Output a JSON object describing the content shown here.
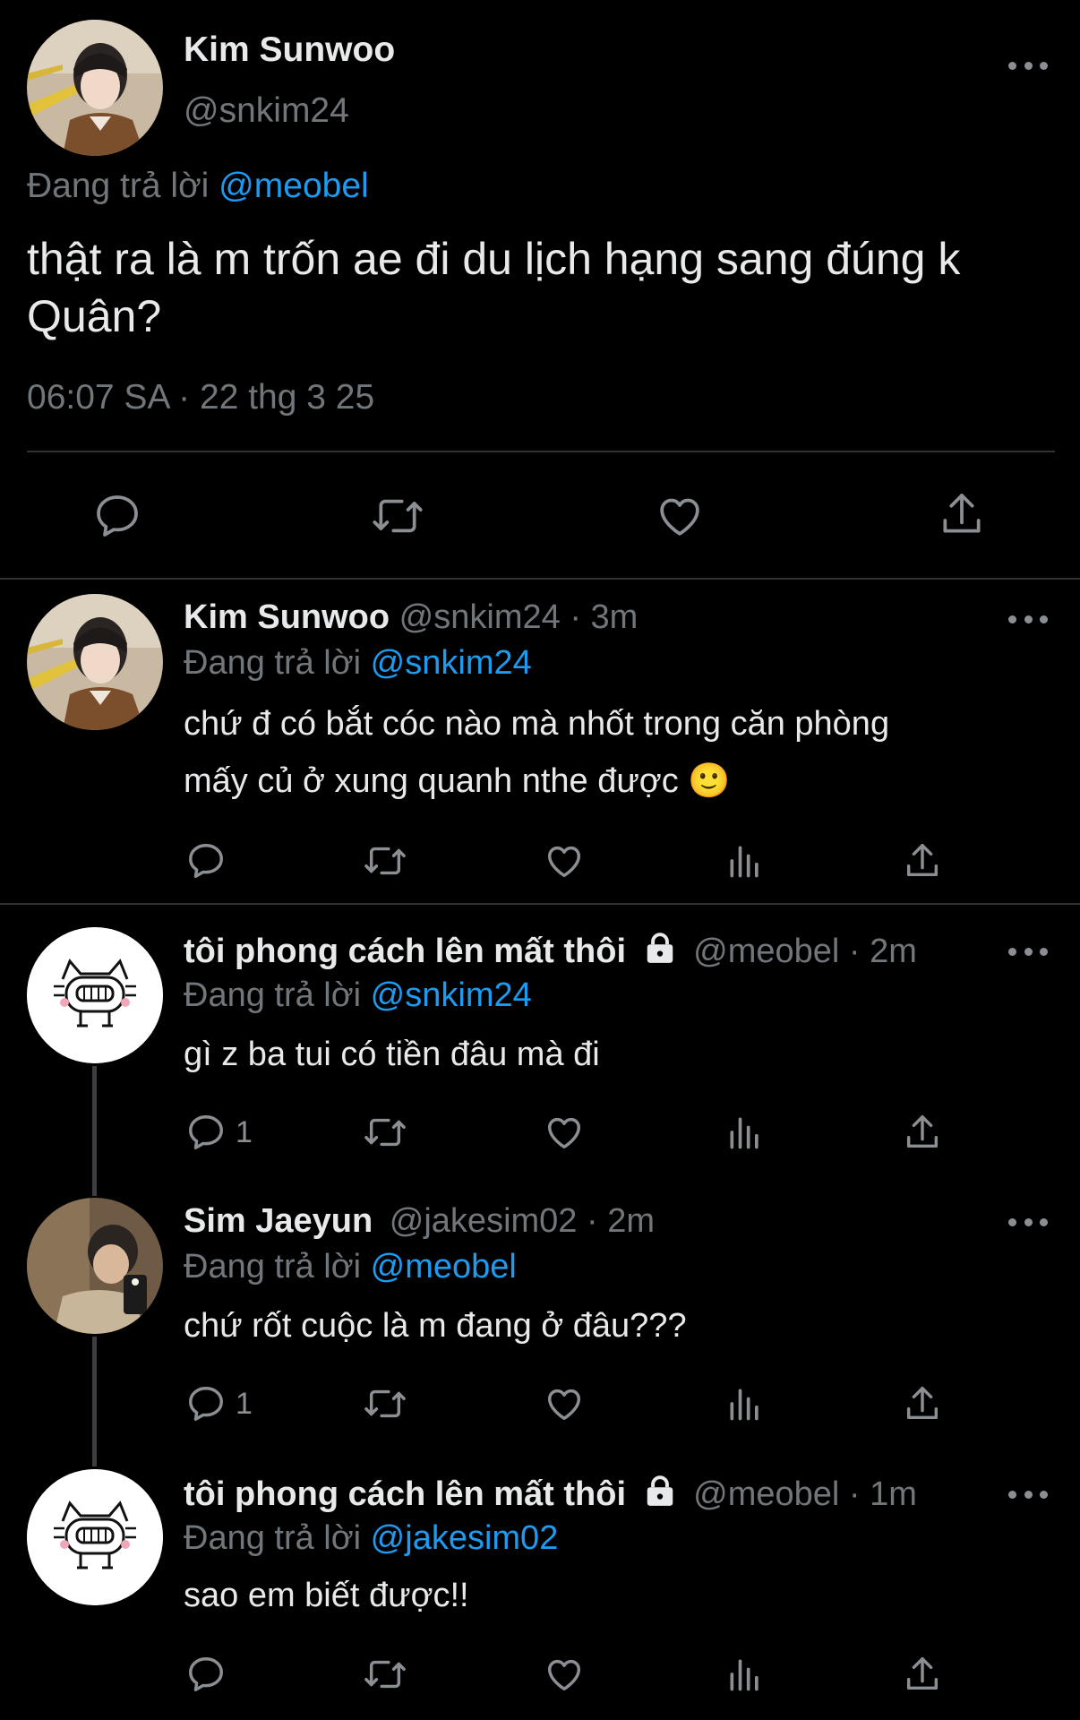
{
  "main_tweet": {
    "name": "Kim Sunwoo",
    "handle": "@snkim24",
    "replying_prefix": "Đang trả lời",
    "replying_to": "@meobel",
    "text_line1": "thật ra là m trốn ae đi du lịch hạng sang đúng k",
    "text_line2": "Quân?",
    "time": "06:07 SA",
    "sep": "·",
    "date": "22 thg 3 25"
  },
  "replies": [
    {
      "name": "Kim Sunwoo",
      "handle": "@snkim24",
      "time": "· 3m",
      "replying_prefix": "Đang trả lời",
      "replying_to": "@snkim24",
      "text_line1": "chứ đ có bắt cóc nào mà nhốt trong căn phòng",
      "text_line2": "mấy củ ở xung quanh nthe được 🙂",
      "reply_count": ""
    },
    {
      "name": "tôi phong cách lên mất thôi",
      "handle": "@meobel",
      "time": "· 2m",
      "replying_prefix": "Đang trả lời",
      "replying_to": "@snkim24",
      "text_line1": "gì z ba tui có tiền đâu mà đi",
      "reply_count": "1"
    },
    {
      "name": "Sim Jaeyun",
      "handle": "@jakesim02",
      "time": "· 2m",
      "replying_prefix": "Đang trả lời",
      "replying_to": "@meobel",
      "text_line1": "chứ rốt cuộc là m đang ở đâu???",
      "reply_count": "1"
    },
    {
      "name": "tôi phong cách lên mất thôi",
      "handle": "@meobel",
      "time": "· 1m",
      "replying_prefix": "Đang trả lời",
      "replying_to": "@jakesim02",
      "text_line1": "sao em biết được!!",
      "reply_count": ""
    }
  ],
  "icons": {
    "reply": "reply-icon",
    "retweet": "retweet-icon",
    "like": "heart-icon",
    "views": "views-icon",
    "share": "share-icon",
    "more": "more-icon",
    "lock": "lock-icon"
  },
  "colors": {
    "background": "#000000",
    "accent": "#1d9bf0",
    "muted": "#71767b",
    "text": "#e7e9ea"
  }
}
